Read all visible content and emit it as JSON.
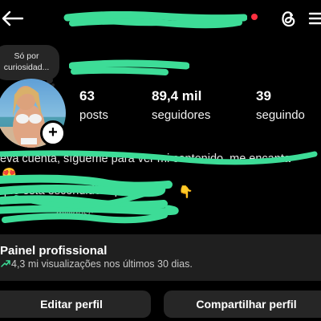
{
  "profile": {
    "note_text": "Só por curiosidad...",
    "stats": {
      "posts_value": "63",
      "posts_label": "posts",
      "followers_value": "89,4 mil",
      "followers_label": "seguidores",
      "following_value": "39",
      "following_label": "seguindo"
    },
    "bio": {
      "line1": "eva cuenta, sígueme para ver mi contenido, me encanta",
      "line2_emoji": "😍",
      "line3": "que está escondido aquí.",
      "line3_emoji": "👇",
      "line4": "millidesc..."
    }
  },
  "dashboard": {
    "title": "Painel profissional",
    "subtitle": "4,3 mi visualizações nos últimos 30 dias."
  },
  "buttons": {
    "edit_label": "Editar perfil",
    "share_label": "Compartilhar perfil"
  },
  "colors": {
    "background": "#000000",
    "redaction": "#3ddc97",
    "notification": "#ff3040",
    "surface": "#262626",
    "trend": "#3ddc97"
  },
  "icons": [
    "back-arrow-icon",
    "threads-icon",
    "menu-icon",
    "add-story-icon",
    "trend-up-icon"
  ]
}
